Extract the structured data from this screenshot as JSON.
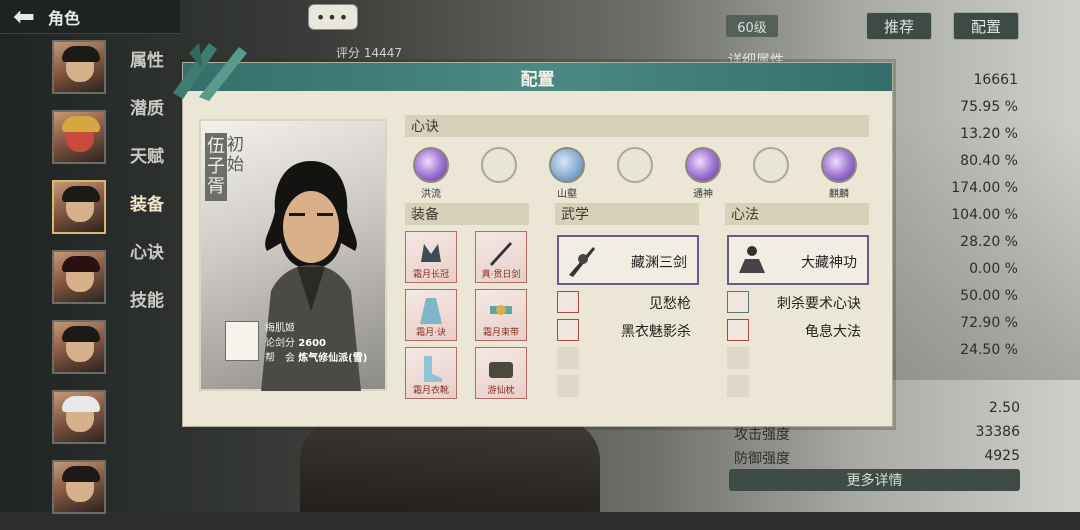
{
  "header": {
    "back_icon": "arrow-left-icon",
    "title": "角色"
  },
  "chat_button": "•••",
  "score_top": "评分 14447",
  "left_menu": [
    {
      "label": "属性"
    },
    {
      "label": "潜质"
    },
    {
      "label": "天赋"
    },
    {
      "label": "装备"
    },
    {
      "label": "心诀"
    },
    {
      "label": "技能"
    }
  ],
  "right_panel": {
    "level": "60级",
    "recommend_button": "推荐",
    "config_button": "配置",
    "detail_title": "详细属性",
    "stat_values": [
      "16661",
      "75.95 %",
      "13.20 %",
      "80.40 %",
      "174.00 %",
      "104.00 %",
      "28.20 %",
      "0.00 %",
      "50.00 %",
      "72.90 %",
      "24.50 %"
    ],
    "extra_rows": [
      {
        "label": "",
        "value": "2.50"
      },
      {
        "label": "攻击强度",
        "value": "33386"
      },
      {
        "label": "防御强度",
        "value": "4925"
      }
    ],
    "more_button": "更多详情"
  },
  "modal": {
    "title": "配置",
    "portrait": {
      "name": "伍子胥",
      "tag": "初始",
      "owner_name": "梅肌姬",
      "lunjian_label": "论剑分",
      "lunjian_value": "2600",
      "guild_label": "帮　会",
      "guild_value": "炼气修仙派(雪)"
    },
    "xinjue": {
      "title": "心诀",
      "slots": [
        {
          "label": "洪流",
          "style": "purple"
        },
        {
          "label": "",
          "style": "empty"
        },
        {
          "label": "山壑",
          "style": "blue"
        },
        {
          "label": "",
          "style": "empty"
        },
        {
          "label": "通神",
          "style": "purple"
        },
        {
          "label": "",
          "style": "empty"
        },
        {
          "label": "麒麟",
          "style": "purple"
        }
      ]
    },
    "equip": {
      "title": "装备",
      "items": [
        {
          "label": "霜月长冠"
        },
        {
          "label": "真·贯日剑"
        },
        {
          "label": "霜月·诀"
        },
        {
          "label": "霜月束带"
        },
        {
          "label": "霜月衣靴"
        },
        {
          "label": "游仙枕"
        }
      ]
    },
    "wuxue": {
      "title": "武学",
      "main": "藏渊三剑",
      "skills": [
        "见愁枪",
        "黑衣魅影杀"
      ]
    },
    "xinfa": {
      "title": "心法",
      "main": "大藏神功",
      "skills": [
        "刺杀要术心诀",
        "龟息大法"
      ]
    }
  }
}
